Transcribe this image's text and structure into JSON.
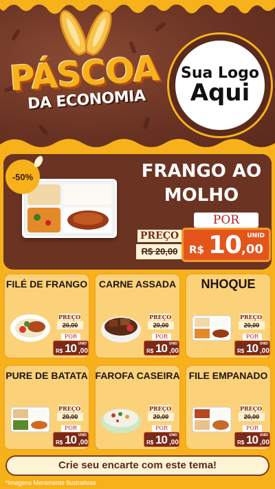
{
  "header": {
    "title_main": "PÁSCOA",
    "title_sub": "DA ECONOMIA",
    "logo_line1": "Sua Logo",
    "logo_line2": "Aqui"
  },
  "featured": {
    "badge": "-50%",
    "name": "FRANGO AO MOLHO",
    "preco_label": "PREÇO",
    "old_price": "R$ 20,00",
    "por_label": "POR",
    "currency": "R$",
    "price_int": "10",
    "price_dec": ",00",
    "unit": "UNID"
  },
  "items": [
    {
      "name": "FILÉ DE FRANGO",
      "preco_label": "PREÇO",
      "old_price": "20,00",
      "por_label": "POR",
      "currency": "R$",
      "price_int": "10",
      "price_dec": ",00",
      "unit": "UNID"
    },
    {
      "name": "CARNE ASSADA",
      "preco_label": "PREÇO",
      "old_price": "20,00",
      "por_label": "POR",
      "currency": "R$",
      "price_int": "10",
      "price_dec": ",00",
      "unit": "UNID"
    },
    {
      "name": "NHOQUE",
      "preco_label": "PREÇO",
      "old_price": "20,00",
      "por_label": "POR",
      "currency": "R$",
      "price_int": "10",
      "price_dec": ",00",
      "unit": "UNID"
    },
    {
      "name": "PURE DE BATATA",
      "preco_label": "PREÇO",
      "old_price": "20,00",
      "por_label": "POR",
      "currency": "R$",
      "price_int": "10",
      "price_dec": ",00",
      "unit": "UNID"
    },
    {
      "name": "FAROFA CASEIRA",
      "preco_label": "PREÇO",
      "old_price": "20,00",
      "por_label": "POR",
      "currency": "R$",
      "price_int": "10",
      "price_dec": ",00",
      "unit": "UNID"
    },
    {
      "name": "FILE EMPANADO",
      "preco_label": "PREÇO",
      "old_price": "20,00",
      "por_label": "POR",
      "currency": "R$",
      "price_int": "10",
      "price_dec": ",00",
      "unit": "UNID"
    }
  ],
  "footer": {
    "cta": "Crie seu encarte com este tema!",
    "disclaimer": "*Imagens Meramente Ilustrativas"
  },
  "colors": {
    "background": "#f7b21b",
    "chocolate": "#6b3322",
    "price_red": "#e4551c",
    "card": "#fbd27a"
  }
}
